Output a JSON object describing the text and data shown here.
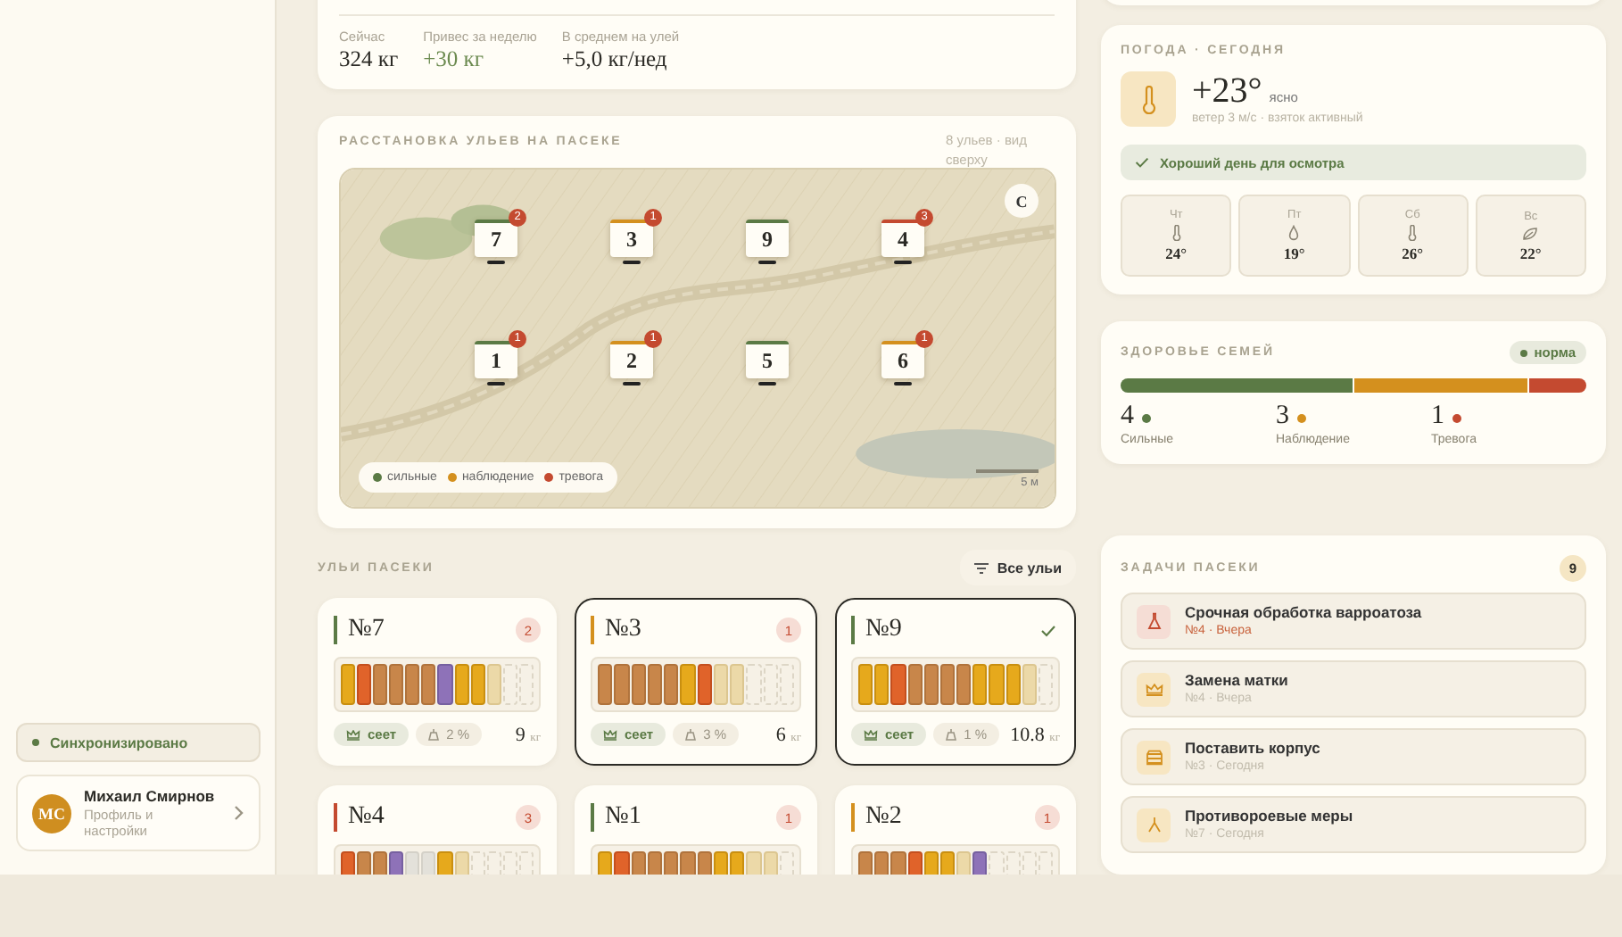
{
  "sidebar": {
    "sync": "Синхронизировано",
    "user": {
      "initials": "МС",
      "name": "Михаил Смирнов",
      "subtitle": "Профиль и настройки"
    }
  },
  "summary": {
    "stats": [
      {
        "label": "Сейчас",
        "value": "324 кг",
        "positive": false
      },
      {
        "label": "Привес за неделю",
        "value": "+30 кг",
        "positive": true
      },
      {
        "label": "В среднем на улей",
        "value": "+5,0 кг/нед",
        "positive": false
      }
    ]
  },
  "map": {
    "title": "РАССТАНОВКА УЛЬЕВ НА ПАСЕКЕ",
    "note": "8 ульев · вид сверху",
    "compass": "С",
    "scale": "5 м",
    "hives": [
      {
        "number": "7",
        "color": "#5b7a45",
        "alerts": "2"
      },
      {
        "number": "3",
        "color": "#d4901e",
        "alerts": "1"
      },
      {
        "number": "9",
        "color": "#5b7a45"
      },
      {
        "number": "4",
        "color": "#c44a30",
        "alerts": "3"
      },
      {
        "number": "1",
        "color": "#5b7a45",
        "alerts": "1"
      },
      {
        "number": "2",
        "color": "#d4901e",
        "alerts": "1"
      },
      {
        "number": "5",
        "color": "#5b7a45"
      },
      {
        "number": "6",
        "color": "#d4901e",
        "alerts": "1"
      }
    ],
    "legend": [
      {
        "label": "сильные",
        "color": "#5b7a45"
      },
      {
        "label": "наблюдение",
        "color": "#d4901e"
      },
      {
        "label": "тревога",
        "color": "#c44a30"
      }
    ]
  },
  "hives_section": {
    "title": "УЛЬИ ПАСЕКИ",
    "filter": "Все ульи",
    "cards": [
      {
        "name": "№7",
        "color": "#5b7a45",
        "alerts": "2",
        "ok": false,
        "selected": false,
        "frames": [
          {
            "kind": "honey"
          },
          {
            "kind": "drone"
          },
          {
            "kind": "brood"
          },
          {
            "kind": "brood"
          },
          {
            "kind": "brood"
          },
          {
            "kind": "brood"
          },
          {
            "kind": "purple"
          },
          {
            "kind": "honey"
          },
          {
            "kind": "honey"
          },
          {
            "kind": "pale"
          },
          {
            "kind": "empty"
          },
          {
            "kind": "empty"
          }
        ],
        "queen": "сеет",
        "mites": "2 %",
        "weight": "9",
        "unit": "кг"
      },
      {
        "name": "№3",
        "color": "#d4901e",
        "alerts": "1",
        "ok": false,
        "selected": true,
        "frames": [
          {
            "kind": "brood"
          },
          {
            "kind": "brood"
          },
          {
            "kind": "brood"
          },
          {
            "kind": "brood"
          },
          {
            "kind": "brood"
          },
          {
            "kind": "honey"
          },
          {
            "kind": "drone"
          },
          {
            "kind": "pale"
          },
          {
            "kind": "pale"
          },
          {
            "kind": "empty"
          },
          {
            "kind": "empty"
          },
          {
            "kind": "empty"
          }
        ],
        "queen": "сеет",
        "mites": "3 %",
        "weight": "6",
        "unit": "кг"
      },
      {
        "name": "№9",
        "color": "#5b7a45",
        "ok": true,
        "selected": true,
        "frames": [
          {
            "kind": "honey"
          },
          {
            "kind": "honey"
          },
          {
            "kind": "drone"
          },
          {
            "kind": "brood"
          },
          {
            "kind": "brood"
          },
          {
            "kind": "brood"
          },
          {
            "kind": "brood"
          },
          {
            "kind": "honey"
          },
          {
            "kind": "honey"
          },
          {
            "kind": "honey"
          },
          {
            "kind": "pale"
          },
          {
            "kind": "empty"
          }
        ],
        "queen": "сеет",
        "mites": "1 %",
        "weight": "10.8",
        "unit": "кг"
      },
      {
        "name": "№4",
        "color": "#c44a30",
        "alerts": "3",
        "ok": false,
        "selected": false,
        "frames": [
          {
            "kind": "drone"
          },
          {
            "kind": "brood"
          },
          {
            "kind": "brood"
          },
          {
            "kind": "purple"
          },
          {
            "kind": "grey"
          },
          {
            "kind": "grey"
          },
          {
            "kind": "honey"
          },
          {
            "kind": "pale"
          },
          {
            "kind": "empty"
          },
          {
            "kind": "empty"
          },
          {
            "kind": "empty"
          },
          {
            "kind": "empty"
          }
        ]
      },
      {
        "name": "№1",
        "color": "#5b7a45",
        "alerts": "1",
        "ok": false,
        "selected": false,
        "frames": [
          {
            "kind": "honey"
          },
          {
            "kind": "drone"
          },
          {
            "kind": "brood"
          },
          {
            "kind": "brood"
          },
          {
            "kind": "brood"
          },
          {
            "kind": "brood"
          },
          {
            "kind": "brood"
          },
          {
            "kind": "honey"
          },
          {
            "kind": "honey"
          },
          {
            "kind": "pale"
          },
          {
            "kind": "pale"
          },
          {
            "kind": "empty"
          }
        ]
      },
      {
        "name": "№2",
        "color": "#d4901e",
        "alerts": "1",
        "ok": false,
        "selected": false,
        "frames": [
          {
            "kind": "brood"
          },
          {
            "kind": "brood"
          },
          {
            "kind": "brood"
          },
          {
            "kind": "drone"
          },
          {
            "kind": "honey"
          },
          {
            "kind": "honey"
          },
          {
            "kind": "pale"
          },
          {
            "kind": "purple"
          },
          {
            "kind": "empty"
          },
          {
            "kind": "empty"
          },
          {
            "kind": "empty"
          },
          {
            "kind": "empty"
          }
        ]
      }
    ]
  },
  "weather": {
    "title": "ПОГОДА · СЕГОДНЯ",
    "temp": "+23°",
    "condition": "ясно",
    "details": "ветер 3 м/с · взяток активный",
    "advice": "Хороший день для осмотра",
    "forecast": [
      {
        "day": "Чт",
        "kind": "thermometer",
        "temp": "24°"
      },
      {
        "day": "Пт",
        "kind": "drop",
        "temp": "19°"
      },
      {
        "day": "Сб",
        "kind": "thermometer",
        "temp": "26°"
      },
      {
        "day": "Вс",
        "kind": "leaf",
        "temp": "22°"
      }
    ]
  },
  "health": {
    "title": "ЗДОРОВЬЕ СЕМЕЙ",
    "status": "норма",
    "groups": [
      {
        "count": "4",
        "label": "Сильные",
        "color": "#5b7a45"
      },
      {
        "count": "3",
        "label": "Наблюдение",
        "color": "#d4901e"
      },
      {
        "count": "1",
        "label": "Тревога",
        "color": "#c44a30"
      }
    ]
  },
  "tasks": {
    "title": "ЗАДАЧИ ПАСЕКИ",
    "count": "9",
    "items": [
      {
        "kind": "mite",
        "title": "Срочная обработка варроатоза",
        "meta": "№4 · Вчера",
        "urgent": true
      },
      {
        "kind": "crown",
        "title": "Замена матки",
        "meta": "№4 · Вчера",
        "urgent": false
      },
      {
        "kind": "box",
        "title": "Поставить корпус",
        "meta": "№3 · Сегодня",
        "urgent": false
      },
      {
        "kind": "swarm",
        "title": "Противороевые меры",
        "meta": "№7 · Сегодня",
        "urgent": false
      }
    ]
  }
}
